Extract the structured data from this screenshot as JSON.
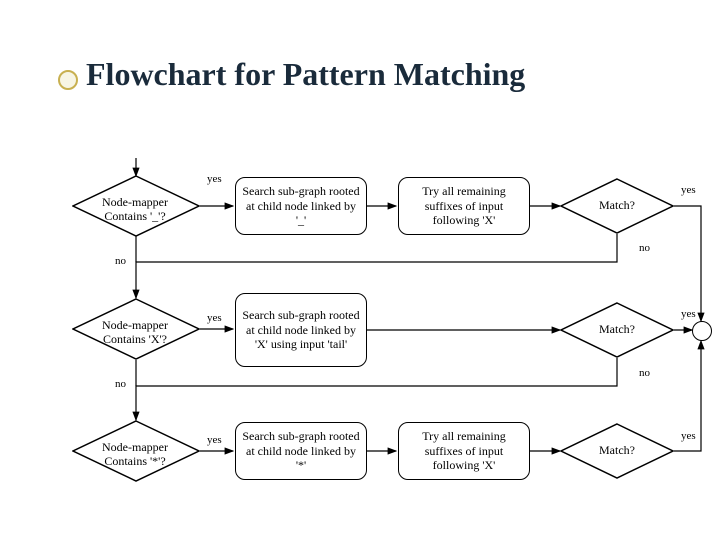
{
  "title": "Flowchart for Pattern Matching",
  "decisions": {
    "d1": "Node-mapper Contains '_'?",
    "d2": "Node-mapper Contains 'X'?",
    "d3": "Node-mapper Contains '*'?",
    "m1": "Match?",
    "m2": "Match?",
    "m3": "Match?"
  },
  "processes": {
    "p1": "Search sub-graph rooted at child node linked by '_'",
    "p2": "Try all remaining suffixes of input following 'X'",
    "p3": "Search sub-graph rooted at child node linked by 'X' using input 'tail'",
    "p4": "Search sub-graph rooted at child node linked by '*'",
    "p5": "Try all remaining suffixes of input following 'X'"
  },
  "labels": {
    "yes": "yes",
    "no": "no"
  }
}
